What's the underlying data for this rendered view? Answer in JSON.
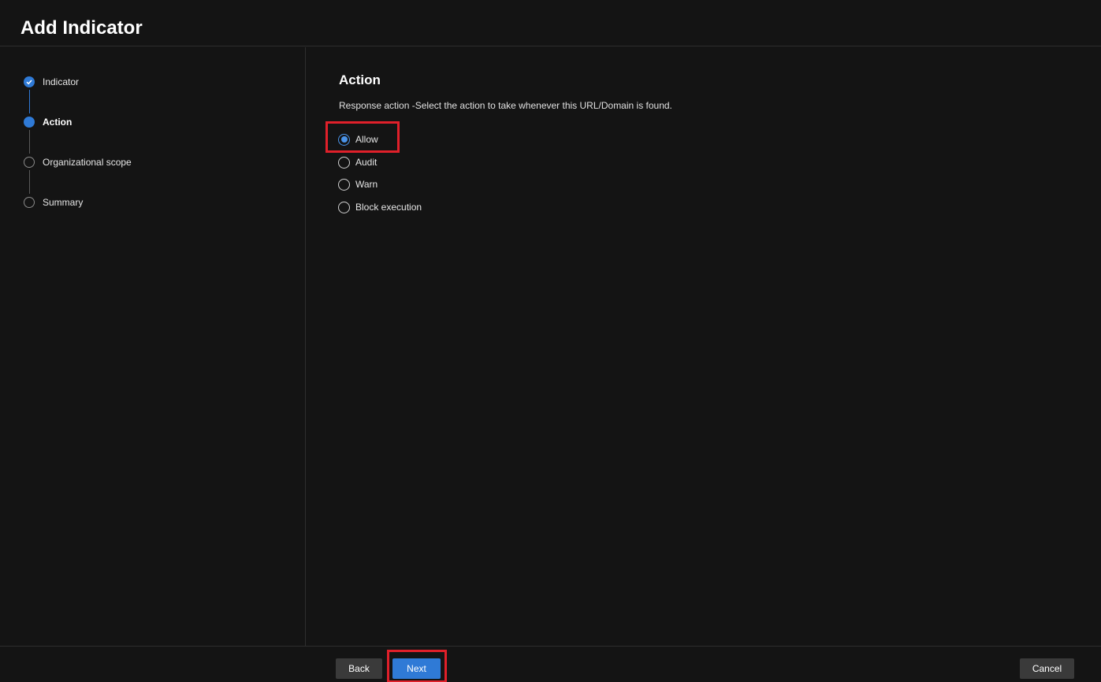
{
  "header": {
    "title": "Add Indicator"
  },
  "wizard": {
    "steps": [
      {
        "label": "Indicator",
        "state": "completed"
      },
      {
        "label": "Action",
        "state": "current"
      },
      {
        "label": "Organizational scope",
        "state": "pending"
      },
      {
        "label": "Summary",
        "state": "pending"
      }
    ]
  },
  "action": {
    "title": "Action",
    "description": "Response action -Select the action to take whenever this URL/Domain is found.",
    "options": [
      {
        "label": "Allow",
        "selected": true
      },
      {
        "label": "Audit",
        "selected": false
      },
      {
        "label": "Warn",
        "selected": false
      },
      {
        "label": "Block execution",
        "selected": false
      }
    ]
  },
  "footer": {
    "back_label": "Back",
    "next_label": "Next",
    "cancel_label": "Cancel"
  },
  "colors": {
    "accent": "#2f7ad6",
    "highlight": "#e0202a",
    "background": "#141414"
  }
}
